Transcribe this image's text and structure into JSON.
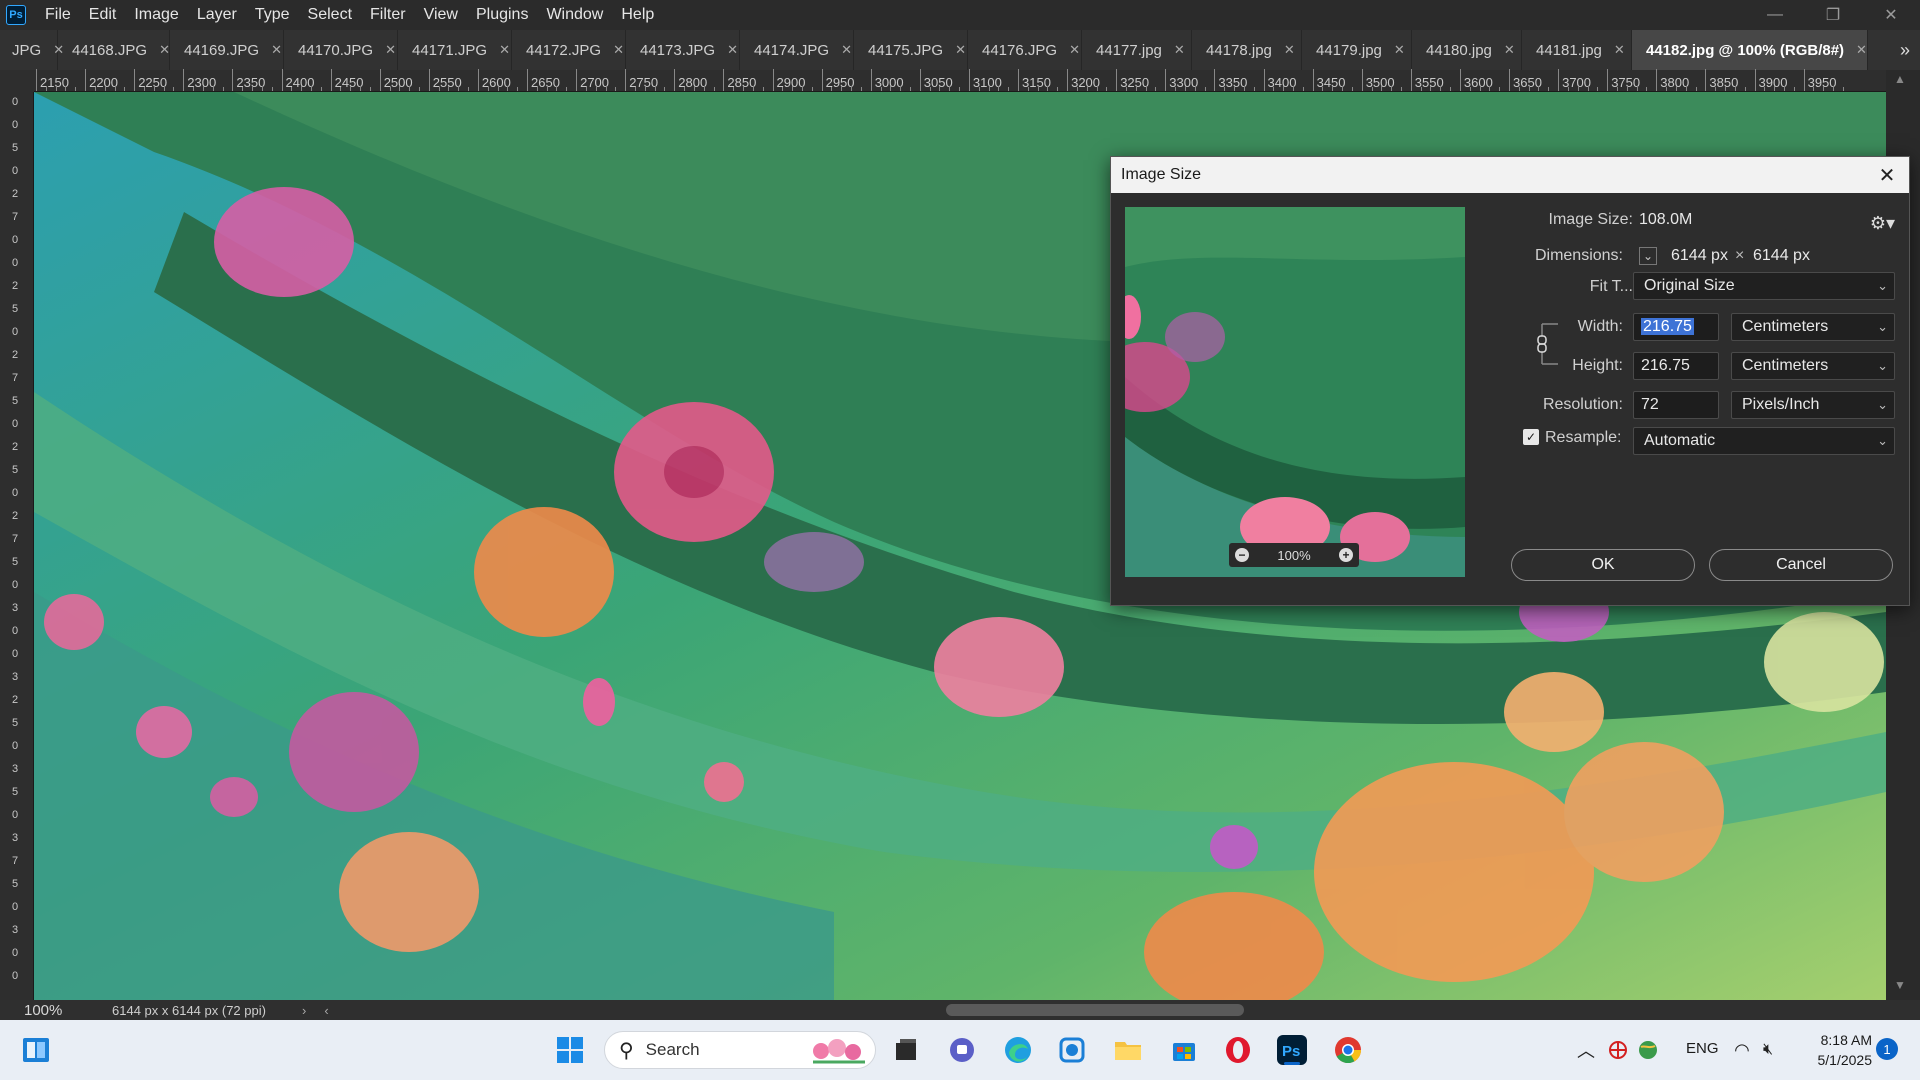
{
  "app": {
    "logo": "Ps"
  },
  "menu": [
    "File",
    "Edit",
    "Image",
    "Layer",
    "Type",
    "Select",
    "Filter",
    "View",
    "Plugins",
    "Window",
    "Help"
  ],
  "tabs": [
    {
      "label": "JPG",
      "active": false
    },
    {
      "label": "44168.JPG",
      "active": false
    },
    {
      "label": "44169.JPG",
      "active": false
    },
    {
      "label": "44170.JPG",
      "active": false
    },
    {
      "label": "44171.JPG",
      "active": false
    },
    {
      "label": "44172.JPG",
      "active": false
    },
    {
      "label": "44173.JPG",
      "active": false
    },
    {
      "label": "44174.JPG",
      "active": false
    },
    {
      "label": "44175.JPG",
      "active": false
    },
    {
      "label": "44176.JPG",
      "active": false
    },
    {
      "label": "44177.jpg",
      "active": false
    },
    {
      "label": "44178.jpg",
      "active": false
    },
    {
      "label": "44179.jpg",
      "active": false
    },
    {
      "label": "44180.jpg",
      "active": false
    },
    {
      "label": "44181.jpg",
      "active": false
    },
    {
      "label": "44182.jpg @ 100% (RGB/8#)",
      "active": true
    }
  ],
  "ruler": {
    "labels": [
      "2150",
      "2200",
      "2250",
      "2300",
      "2350",
      "2400",
      "2450",
      "2500",
      "2550",
      "2600",
      "2650",
      "2700",
      "2750",
      "2800",
      "2850",
      "2900",
      "2950",
      "3000",
      "3050",
      "3100",
      "3150",
      "3200",
      "3250",
      "3300",
      "3350",
      "3400",
      "3450",
      "3500",
      "3550",
      "3600",
      "3650",
      "3700",
      "3750",
      "3800",
      "3850",
      "3900",
      "3950"
    ],
    "vertical_digits": [
      "0",
      "0",
      "5",
      "0",
      "2",
      "7",
      "0",
      "0",
      "2",
      "5",
      "0",
      "2",
      "7",
      "5",
      "0",
      "2",
      "5",
      "0",
      "2",
      "7",
      "5",
      "0",
      "3",
      "0",
      "0",
      "3",
      "2",
      "5",
      "0",
      "3",
      "5",
      "0",
      "3",
      "7",
      "5",
      "0",
      "3",
      "0",
      "0"
    ]
  },
  "status": {
    "zoom": "100%",
    "info": "6144 px x 6144 px (72 ppi)"
  },
  "dialog": {
    "title": "Image Size",
    "image_size_label": "Image Size:",
    "image_size_value": "108.0M",
    "dimensions_label": "Dimensions:",
    "dim_w": "6144 px",
    "dim_x": "×",
    "dim_h": "6144 px",
    "fit_label": "Fit T...",
    "fit_value": "Original Size",
    "width_label": "Width:",
    "width_value": "216.75",
    "width_unit": "Centimeters",
    "height_label": "Height:",
    "height_value": "216.75",
    "height_unit": "Centimeters",
    "resolution_label": "Resolution:",
    "resolution_value": "72",
    "resolution_unit": "Pixels/Inch",
    "resample_label": "Resample:",
    "resample_checked": true,
    "resample_value": "Automatic",
    "preview_zoom": "100%",
    "ok_label": "OK",
    "cancel_label": "Cancel"
  },
  "taskbar": {
    "search_label": "Search",
    "lang": "ENG",
    "time": "8:18 AM",
    "date": "5/1/2025",
    "notifications": "1"
  }
}
